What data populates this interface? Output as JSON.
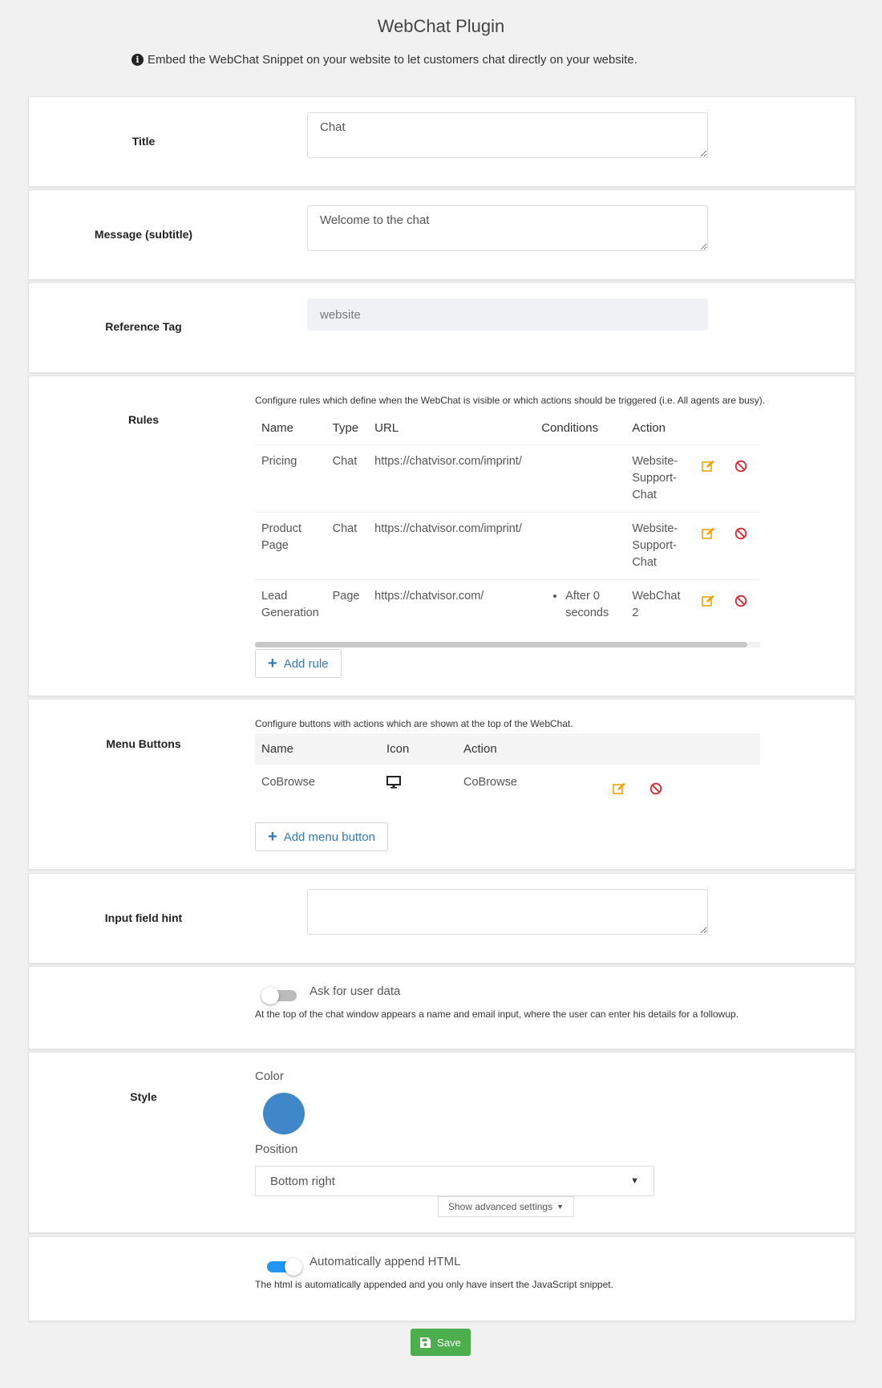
{
  "header": {
    "title": "WebChat Plugin",
    "intro": "Embed the WebChat Snippet on your website to let customers chat directly on your website."
  },
  "title_section": {
    "label": "Title",
    "value": "Chat"
  },
  "subtitle_section": {
    "label": "Message (subtitle)",
    "value": "Welcome to the chat"
  },
  "reference_section": {
    "label": "Reference Tag",
    "value": "website"
  },
  "rules_section": {
    "label": "Rules",
    "description": "Configure rules which define when the WebChat is visible or which actions should be triggered (i.e. All agents are busy).",
    "columns": [
      "Name",
      "Type",
      "URL",
      "Conditions",
      "Action"
    ],
    "rows": [
      {
        "name": "Pricing",
        "type": "Chat",
        "url": "https://chatvisor.com/imprint/",
        "conditions": "",
        "action": "Website-Support-Chat"
      },
      {
        "name": "Product Page",
        "type": "Chat",
        "url": "https://chatvisor.com/imprint/",
        "conditions": "",
        "action": "Website-Support-Chat"
      },
      {
        "name": "Lead Generation",
        "type": "Page",
        "url": "https://chatvisor.com/",
        "conditions": "After 0 seconds",
        "action": "WebChat 2"
      }
    ],
    "add_label": "Add rule"
  },
  "menu_section": {
    "label": "Menu Buttons",
    "description": "Configure buttons with actions which are shown at the top of the WebChat.",
    "columns": [
      "Name",
      "Icon",
      "Action"
    ],
    "rows": [
      {
        "name": "CoBrowse",
        "icon": "monitor-icon",
        "action": "CoBrowse"
      }
    ],
    "add_label": "Add menu button"
  },
  "hint_section": {
    "label": "Input field hint",
    "value": ""
  },
  "user_data_section": {
    "toggle_label": "Ask for user data",
    "toggle_on": false,
    "description": "At the top of the chat window appears a name and email input, where the user can enter his details for a followup."
  },
  "style_section": {
    "label": "Style",
    "color_label": "Color",
    "color": "#3f87c9",
    "position_label": "Position",
    "position_value": "Bottom right",
    "advanced_label": "Show advanced settings"
  },
  "append_section": {
    "toggle_label": "Automatically append HTML",
    "toggle_on": true,
    "description": "The html is automatically appended and you only have insert the JavaScript snippet."
  },
  "footer": {
    "save_label": "Save"
  },
  "colors": {
    "accent": "#2196f3",
    "link": "#337ab7",
    "edit": "#f0a30a",
    "delete": "#d9252c",
    "save": "#4cae4c"
  }
}
